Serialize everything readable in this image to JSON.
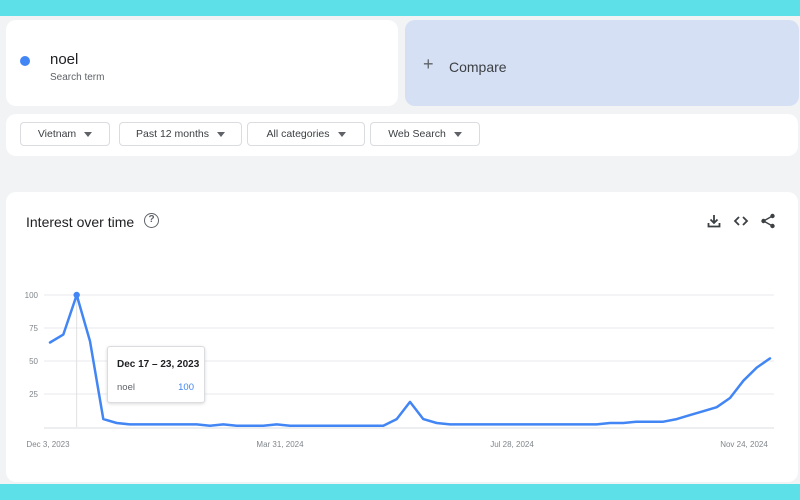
{
  "search_term": {
    "name": "noel",
    "subtitle": "Search term",
    "color": "#4285f4"
  },
  "compare": {
    "icon": "plus-icon",
    "label": "Compare"
  },
  "filters": [
    {
      "label": "Vietnam"
    },
    {
      "label": "Past 12 months"
    },
    {
      "label": "All categories"
    },
    {
      "label": "Web Search"
    }
  ],
  "chart_section": {
    "title": "Interest over time",
    "help_icon": "help-circle-icon",
    "actions": [
      "download-icon",
      "embed-code-icon",
      "share-icon"
    ]
  },
  "tooltip": {
    "date": "Dec 17 – 23, 2023",
    "term": "noel",
    "value": "100"
  },
  "chart_data": {
    "type": "line",
    "title": "",
    "xlabel": "",
    "ylabel": "",
    "ylim": [
      0,
      100
    ],
    "yticks": [
      "100",
      "75",
      "50",
      "25"
    ],
    "xticks": [
      "Dec 3, 2023",
      "Mar 31, 2024",
      "Jul 28, 2024",
      "Nov 24, 2024"
    ],
    "grid": true,
    "series": [
      {
        "name": "noel",
        "color": "#4285f4",
        "values": [
          64,
          70,
          100,
          65,
          6,
          3,
          2,
          2,
          2,
          2,
          2,
          2,
          1,
          2,
          1,
          1,
          1,
          2,
          1,
          1,
          1,
          1,
          1,
          1,
          1,
          1,
          6,
          19,
          6,
          3,
          2,
          2,
          2,
          2,
          2,
          2,
          2,
          2,
          2,
          2,
          2,
          2,
          3,
          3,
          4,
          4,
          4,
          6,
          9,
          12,
          15,
          22,
          35,
          45,
          52
        ]
      }
    ]
  }
}
